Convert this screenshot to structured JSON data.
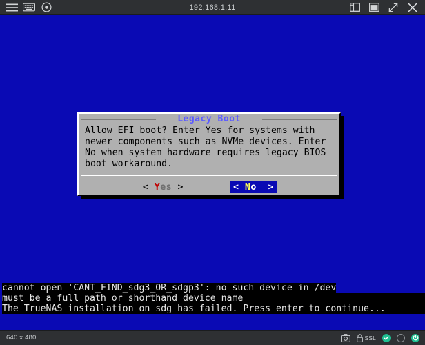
{
  "titlebar": {
    "host": "192.168.1.11",
    "left_icons": [
      {
        "name": "menu-icon",
        "glyph": "hamburger"
      },
      {
        "name": "keyboard-icon",
        "glyph": "keyboard"
      },
      {
        "name": "record-icon",
        "glyph": "record"
      }
    ],
    "right_icons": [
      {
        "name": "sidebar-toggle-icon",
        "glyph": "panel"
      },
      {
        "name": "window-restore-icon",
        "glyph": "window"
      },
      {
        "name": "fullscreen-icon",
        "glyph": "expand"
      },
      {
        "name": "close-icon",
        "glyph": "close"
      }
    ]
  },
  "screen": {
    "background_color": "#0a0ab4"
  },
  "dialog": {
    "title": "Legacy Boot",
    "title_color": "#5c5cff",
    "background_color": "#b0b0b0",
    "body_lines": [
      "Allow EFI boot? Enter Yes for systems with",
      "newer components such as NVMe devices. Enter",
      "No when system hardware requires legacy BIOS",
      "boot workaround."
    ],
    "buttons": [
      {
        "name": "yes-button",
        "hotkey": "Y",
        "rest": "es",
        "left_bracket": "< ",
        "right_bracket": " >",
        "selected": false
      },
      {
        "name": "no-button",
        "hotkey": "N",
        "rest": "o",
        "left_bracket": "< ",
        "right_bracket": "  >",
        "selected": true,
        "selected_background": "#0a0ab4"
      }
    ]
  },
  "terminal": {
    "lines": [
      {
        "text": "cannot open 'CANT_FIND_sdg3_OR_sdgp3': no such device in /dev",
        "full_width_background": false
      },
      {
        "text": "must be a full path or shorthand device name",
        "full_width_background": true
      },
      {
        "text": "The TrueNAS installation on sdg has failed. Press enter to continue...",
        "full_width_background": true
      }
    ]
  },
  "statusbar": {
    "resolution": "640 x 480",
    "ssl_label": "SSL",
    "icons": [
      {
        "name": "screenshot-icon",
        "glyph": "camera"
      },
      {
        "name": "lock-icon",
        "glyph": "lock"
      }
    ],
    "indicators": [
      {
        "name": "connection-ok-indicator",
        "style": "green-check"
      },
      {
        "name": "secondary-indicator",
        "style": "hollow"
      },
      {
        "name": "power-indicator",
        "style": "green-power"
      }
    ]
  }
}
